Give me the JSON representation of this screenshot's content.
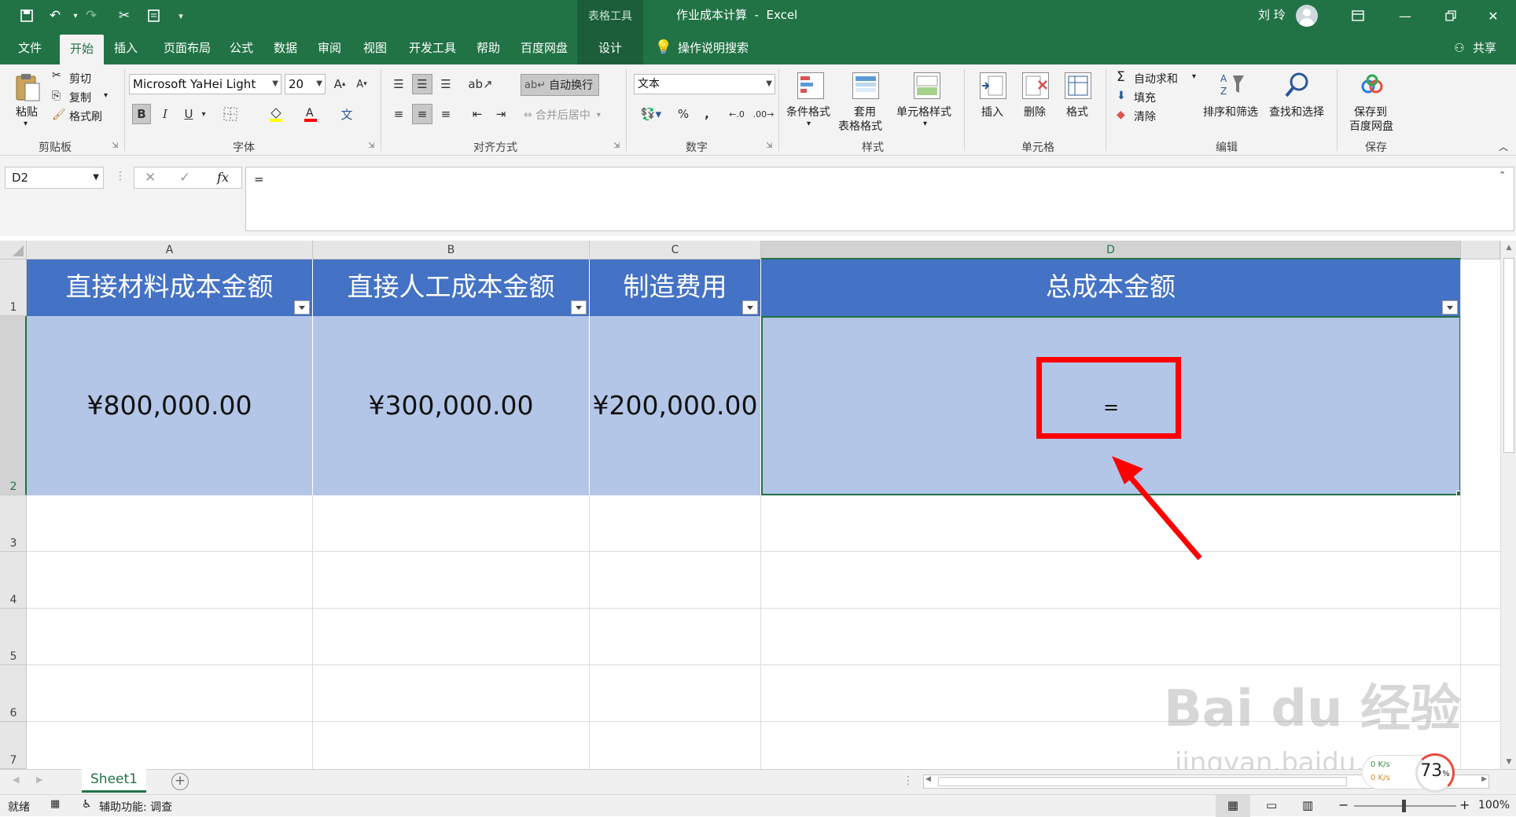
{
  "titlebar": {
    "context_tools": "表格工具",
    "document_title": "作业成本计算  -  Excel",
    "user_name": "刘 玲"
  },
  "tabs": [
    {
      "label": "文件"
    },
    {
      "label": "开始"
    },
    {
      "label": "插入"
    },
    {
      "label": "页面布局"
    },
    {
      "label": "公式"
    },
    {
      "label": "数据"
    },
    {
      "label": "审阅"
    },
    {
      "label": "视图"
    },
    {
      "label": "开发工具"
    },
    {
      "label": "帮助"
    },
    {
      "label": "百度网盘"
    },
    {
      "label": "设计"
    }
  ],
  "tell_me": "操作说明搜索",
  "share": "共享",
  "ribbon": {
    "clipboard": {
      "paste": "粘贴",
      "cut": "剪切",
      "copy": "复制",
      "format_painter": "格式刷",
      "label": "剪贴板"
    },
    "font": {
      "name": "Microsoft YaHei Light",
      "size": "20",
      "bold": "B",
      "italic": "I",
      "underline": "U",
      "label": "字体"
    },
    "alignment": {
      "wrap_text": "自动换行",
      "merge_center": "合并后居中",
      "label": "对齐方式"
    },
    "number": {
      "format": "文本",
      "label": "数字"
    },
    "styles": {
      "conditional": "条件格式",
      "table_format": "套用",
      "table_format2": "表格格式",
      "cell_styles": "单元格样式",
      "label": "样式"
    },
    "cells": {
      "insert": "插入",
      "delete": "删除",
      "format": "格式",
      "label": "单元格"
    },
    "editing": {
      "autosum": "自动求和",
      "fill": "填充",
      "clear": "清除",
      "sort_filter": "排序和筛选",
      "find_select": "查找和选择",
      "label": "编辑"
    },
    "save": {
      "save_to": "保存到",
      "baidu_disk": "百度网盘",
      "label": "保存"
    }
  },
  "formula_bar": {
    "name_box": "D2",
    "fx": "fx",
    "formula": "="
  },
  "columns": [
    "A",
    "B",
    "C",
    "D"
  ],
  "rows": [
    "1",
    "2",
    "3",
    "4",
    "5",
    "6",
    "7"
  ],
  "table": {
    "headers": [
      "直接材料成本金额",
      "直接人工成本金额",
      "制造费用",
      "总成本金额"
    ],
    "values": [
      "¥800,000.00",
      "¥300,000.00",
      "¥200,000.00",
      "="
    ]
  },
  "sheet_tabs": [
    "Sheet1"
  ],
  "status": {
    "ready": "就绪",
    "accessibility": "辅助功能: 调查",
    "zoom": "100%",
    "net_up": "0  K/s",
    "net_down": "0  K/s",
    "cpu": "73",
    "cpu_unit": "%"
  },
  "watermark": {
    "line1": "Bai du 经验",
    "line2": "jingyan.baidu.com"
  },
  "colors": {
    "excel_green": "#217346",
    "header_blue": "#4472c4",
    "cell_blue": "#b4c6e7",
    "highlight_red": "#ff0000"
  }
}
